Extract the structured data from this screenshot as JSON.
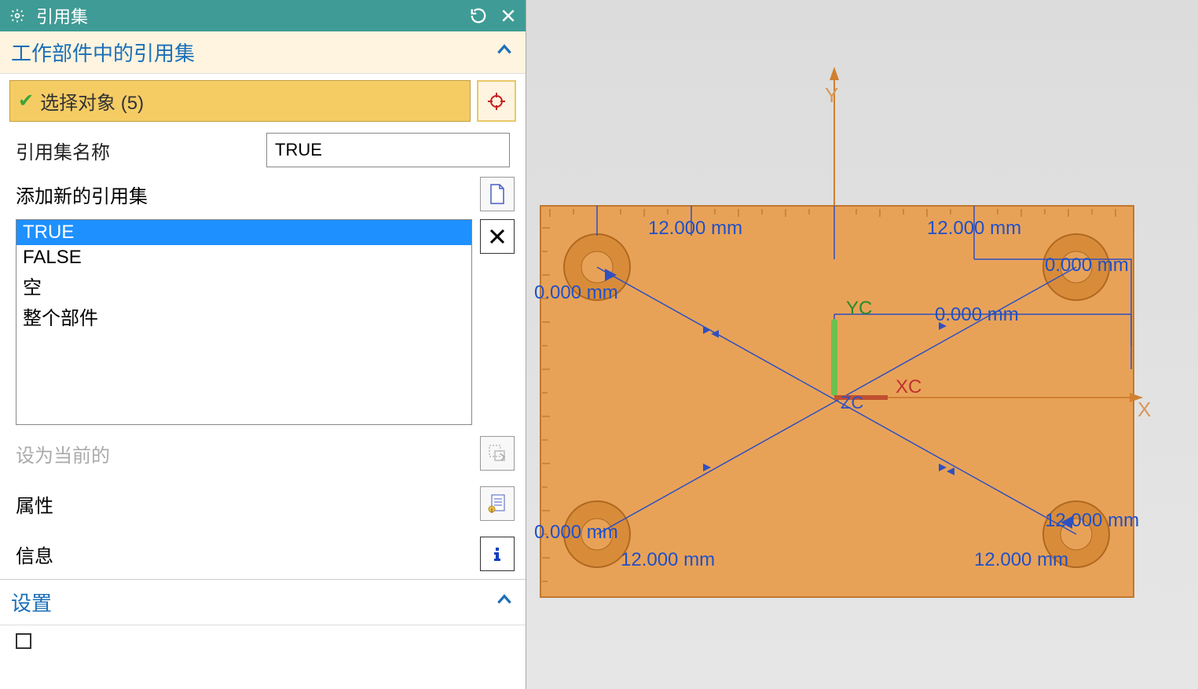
{
  "titlebar": {
    "title": "引用集"
  },
  "section1": {
    "title": "工作部件中的引用集"
  },
  "select_objects": {
    "label": "选择对象 (5)"
  },
  "refset_name": {
    "label": "引用集名称",
    "value": "TRUE"
  },
  "add_refset": {
    "label": "添加新的引用集"
  },
  "list_items": [
    "TRUE",
    "FALSE",
    "空",
    "整个部件"
  ],
  "set_current": {
    "label": "设为当前的"
  },
  "properties": {
    "label": "属性"
  },
  "info": {
    "label": "信息"
  },
  "settings": {
    "title": "设置"
  },
  "viewport": {
    "dims": {
      "top_left": "12.000 mm",
      "top_right": "12.000 mm",
      "bot_left": "12.000 mm",
      "bot_right": "12.000 mm",
      "mid_left_a": "0.000 mm",
      "mid_left_b": "0.000 mm",
      "mid_right": "0.000 mm",
      "mid_right2": "0.000 mm",
      "bl2": "12.000 mm"
    },
    "axes": {
      "Y": "Y",
      "X": "X",
      "YC": "YC",
      "XC": "XC",
      "ZC": "ZC"
    }
  }
}
